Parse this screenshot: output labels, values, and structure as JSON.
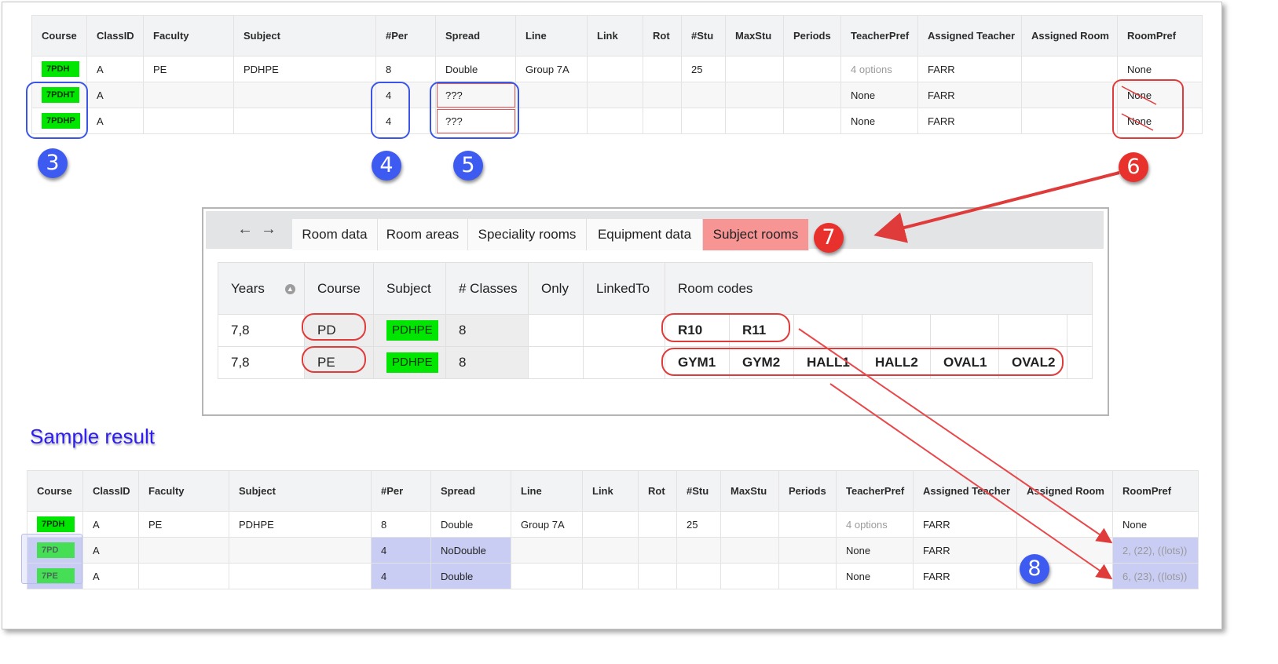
{
  "columns": [
    "Course",
    "ClassID",
    "Faculty",
    "Subject",
    "#Per",
    "Spread",
    "Line",
    "Link",
    "Rot",
    "#Stu",
    "MaxStu",
    "Periods",
    "TeacherPref",
    "Assigned Teacher",
    "Assigned Room",
    "RoomPref"
  ],
  "top_table": {
    "rows": [
      {
        "course": "7PDH",
        "classid": "A",
        "faculty": "PE",
        "subject": "PDHPE",
        "per": "8",
        "spread": "Double",
        "line": "Group 7A",
        "link": "",
        "rot": "",
        "stu": "25",
        "maxstu": "",
        "periods": "",
        "teacherpref": "4 options",
        "teacher": "FARR",
        "room": "",
        "roompref": "None"
      },
      {
        "course": "7PDHT",
        "classid": "A",
        "faculty": "",
        "subject": "",
        "per": "4",
        "spread": "???",
        "line": "",
        "link": "",
        "rot": "",
        "stu": "",
        "maxstu": "",
        "periods": "",
        "teacherpref": "None",
        "teacher": "FARR",
        "room": "",
        "roompref": "None"
      },
      {
        "course": "7PDHP",
        "classid": "A",
        "faculty": "",
        "subject": "",
        "per": "4",
        "spread": "???",
        "line": "",
        "link": "",
        "rot": "",
        "stu": "",
        "maxstu": "",
        "periods": "",
        "teacherpref": "None",
        "teacher": "FARR",
        "room": "",
        "roompref": "None"
      }
    ]
  },
  "dialog": {
    "tabs": [
      "Room data",
      "Room areas",
      "Speciality rooms",
      "Equipment data",
      "Subject rooms"
    ],
    "active_tab": "Subject rooms",
    "headers": {
      "years": "Years",
      "course": "Course",
      "subject": "Subject",
      "classes": "# Classes",
      "only": "Only",
      "linkedto": "LinkedTo",
      "roomcodes": "Room codes"
    },
    "rows": [
      {
        "years": "7,8",
        "course": "PD",
        "subject": "PDHPE",
        "classes": "8",
        "only": "",
        "linkedto": "",
        "rooms": [
          "R10",
          "R11",
          "",
          "",
          "",
          ""
        ]
      },
      {
        "years": "7,8",
        "course": "PE",
        "subject": "PDHPE",
        "classes": "8",
        "only": "",
        "linkedto": "",
        "rooms": [
          "GYM1",
          "GYM2",
          "HALL1",
          "HALL2",
          "OVAL1",
          "OVAL2"
        ]
      }
    ]
  },
  "sample_title": "Sample result",
  "bottom_table": {
    "rows": [
      {
        "course": "7PDH",
        "classid": "A",
        "faculty": "PE",
        "subject": "PDHPE",
        "per": "8",
        "spread": "Double",
        "line": "Group 7A",
        "link": "",
        "rot": "",
        "stu": "25",
        "maxstu": "",
        "periods": "",
        "teacherpref": "4 options",
        "teacher": "FARR",
        "room": "",
        "roompref": "None"
      },
      {
        "course": "7PD",
        "classid": "A",
        "faculty": "",
        "subject": "",
        "per": "4",
        "spread": "NoDouble",
        "line": "",
        "link": "",
        "rot": "",
        "stu": "",
        "maxstu": "",
        "periods": "",
        "teacherpref": "None",
        "teacher": "FARR",
        "room": "",
        "roompref": "2, (22), ((lots))"
      },
      {
        "course": "7PE",
        "classid": "A",
        "faculty": "",
        "subject": "",
        "per": "4",
        "spread": "Double",
        "line": "",
        "link": "",
        "rot": "",
        "stu": "",
        "maxstu": "",
        "periods": "",
        "teacherpref": "None",
        "teacher": "FARR",
        "room": "",
        "roompref": "6, (23), ((lots))"
      }
    ]
  },
  "markers": [
    "3",
    "4",
    "5",
    "6",
    "7",
    "8"
  ],
  "colors": {
    "badge_green": "#00e600",
    "marker_blue": "#3d5bf0",
    "marker_red": "#e8302c",
    "active_tab": "#f79494",
    "highlight": "#c9cdf3",
    "title_blue": "#2e1df0"
  }
}
